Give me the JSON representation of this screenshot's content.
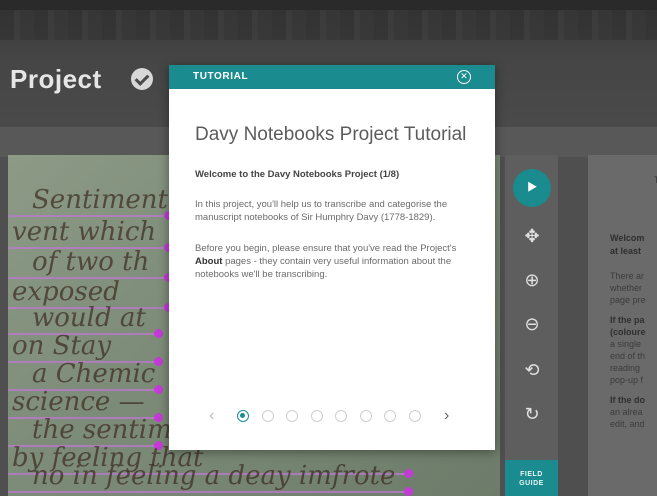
{
  "project": {
    "title": "Project"
  },
  "tutorial": {
    "header_label": "TUTORIAL",
    "title": "Davy Notebooks Project Tutorial",
    "subtitle": "Welcome to the Davy Notebooks Project (1/8)",
    "para1": "In this project, you'll help us to transcribe and categorise the manuscript notebooks of Sir Humphry Davy (1778-1829).",
    "para2_before": "Before you begin, please ensure that you've read the Project's ",
    "para2_bold": "About",
    "para2_after": " pages - they contain very useful information about the notebooks we'll be transcribing.",
    "current_step": 1,
    "total_steps": 8,
    "prev_glyph": "‹",
    "next_glyph": "›"
  },
  "toolbar": {
    "tools": [
      {
        "name": "pointer-tool",
        "icon": "cursor-icon",
        "glyph": "⯈",
        "active": true
      },
      {
        "name": "move-tool",
        "icon": "move-icon",
        "glyph": "✥",
        "active": false
      },
      {
        "name": "zoom-in-tool",
        "icon": "zoom-in-icon",
        "glyph": "⊕",
        "active": false
      },
      {
        "name": "zoom-out-tool",
        "icon": "zoom-out-icon",
        "glyph": "⊖",
        "active": false
      },
      {
        "name": "rotate-tool",
        "icon": "rotate-icon",
        "glyph": "⟲",
        "active": false
      },
      {
        "name": "reset-tool",
        "icon": "reset-icon",
        "glyph": "↻",
        "active": false
      }
    ],
    "field_guide_line1": "FIELD",
    "field_guide_line2": "GUIDE"
  },
  "right_panel": {
    "top_letter": "T",
    "welcome_1": "Welcom",
    "welcome_2": "at least",
    "p1": [
      "There ar",
      "whether",
      "page pre"
    ],
    "h2_1": "If the pa",
    "h2_2": "(coloure",
    "p2": [
      "a single",
      "end of th",
      "reading",
      "pop-up f"
    ],
    "h3": "If the do",
    "p3": [
      "an alrea",
      "edit, and"
    ]
  },
  "manuscript": {
    "ink_lines": [
      "Sentiment",
      "vent which",
      "of two th",
      "exposed",
      "would at",
      "on Stay",
      "a Chemic",
      "science —",
      "the sentime",
      "by feeling that",
      "no in feeling a deay imfrote"
    ]
  },
  "colors": {
    "accent": "#1a8c8f",
    "marker": "#c43bd8"
  }
}
